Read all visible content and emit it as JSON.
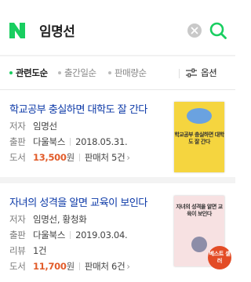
{
  "search": {
    "query": "임명선",
    "logo_icon": "naver-n-logo",
    "clear_icon": "clear-x-icon",
    "search_icon": "green-search-icon",
    "accent_color": "#19ce60"
  },
  "sort": {
    "items": [
      {
        "label": "관련도순",
        "active": true
      },
      {
        "label": "출간일순",
        "active": false
      },
      {
        "label": "판매량순",
        "active": false
      }
    ],
    "options_label": "옵션",
    "options_icon": "sliders-icon"
  },
  "books": [
    {
      "title": "학교공부 충실하면 대학도 잘 간다",
      "author_label": "저자",
      "author": "임명선",
      "publisher_label": "출판",
      "publisher": "다울북스",
      "date": "2018.05.31.",
      "price_label": "도서",
      "price": "13,500",
      "price_unit": "원",
      "seller_text": "판매처 5건",
      "cover_text": "학교공부 충실하면 대학도 잘 간다"
    },
    {
      "title": "자녀의 성격을 알면 교육이 보인다",
      "author_label": "저자",
      "author": "임명선, 황청화",
      "publisher_label": "출판",
      "publisher": "다울북스",
      "date": "2019.03.04.",
      "review_label": "리뷰",
      "review": "1건",
      "price_label": "도서",
      "price": "11,700",
      "price_unit": "원",
      "seller_text": "판매처 6건",
      "cover_text": "자녀의 성격을 알면 교육이 보인다",
      "badge": "베스트 셀러"
    }
  ]
}
